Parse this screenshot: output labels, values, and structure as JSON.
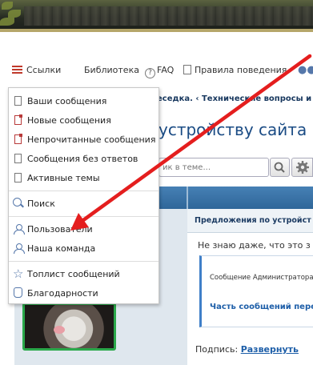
{
  "nav": {
    "links_label": "Ссылки",
    "library_label": "Библиотека",
    "faq_label": "FAQ",
    "rules_label": "Правила поведения"
  },
  "breadcrumb": "еседка. ‹ Технические вопросы и",
  "thread_title": "устройству сайта и",
  "search": {
    "placeholder": "ик в теме..."
  },
  "menu": {
    "items": [
      "Ваши сообщения",
      "Новые сообщения",
      "Непрочитанные сообщения",
      "Сообщения без ответов",
      "Активные темы",
      "Поиск",
      "Пользователи",
      "Наша команда",
      "Топлист сообщений",
      "Благодарности"
    ]
  },
  "post": {
    "topic_header": "Предложения по устройст",
    "text": "Не знаю даже, что это з",
    "admin_box_title": "Сообщение Администратора",
    "admin_box_part": "Часть сообщений пере",
    "signature_label": "Подпись:",
    "signature_link": "Развернуть"
  },
  "colors": {
    "accent_red": "#e41e1e",
    "link_blue": "#1d5ea8",
    "avatar_border": "#2aa84a"
  }
}
